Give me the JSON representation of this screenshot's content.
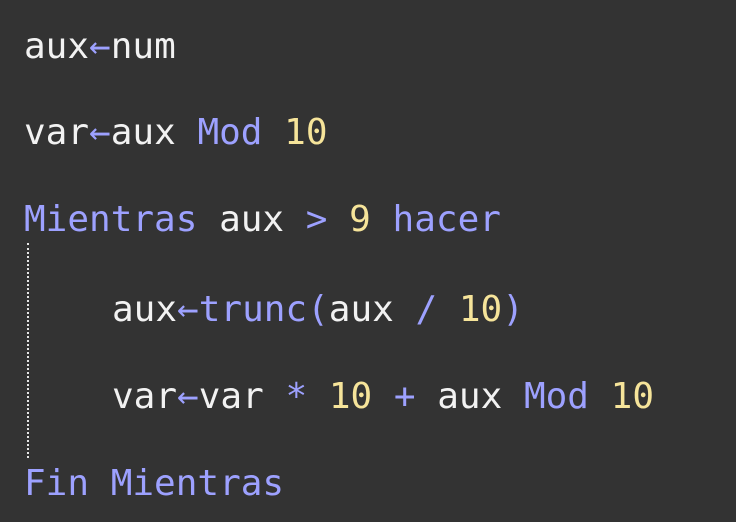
{
  "colors": {
    "background": "#333333",
    "identifier": "#f2f2f2",
    "keyword": "#9da1ff",
    "number": "#f6e49a"
  },
  "code": {
    "line1": {
      "a": "aux",
      "arrow": "←",
      "b": "num"
    },
    "line2": {
      "a": "var",
      "arrow": "←",
      "b": "aux",
      "kw": "Mod",
      "n": "10"
    },
    "line3": {
      "kw1": "Mientras",
      "a": "aux",
      "op": ">",
      "n": "9",
      "kw2": "hacer"
    },
    "line4": {
      "a": "aux",
      "arrow": "←",
      "fn": "trunc",
      "open": "(",
      "b": "aux",
      "op": "/",
      "n": "10",
      "close": ")"
    },
    "line5": {
      "a": "var",
      "arrow": "←",
      "b": "var",
      "op1": "*",
      "n1": "10",
      "op2": "+",
      "c": "aux",
      "kw": "Mod",
      "n2": "10"
    },
    "line6": {
      "kw": "Fin Mientras"
    }
  }
}
